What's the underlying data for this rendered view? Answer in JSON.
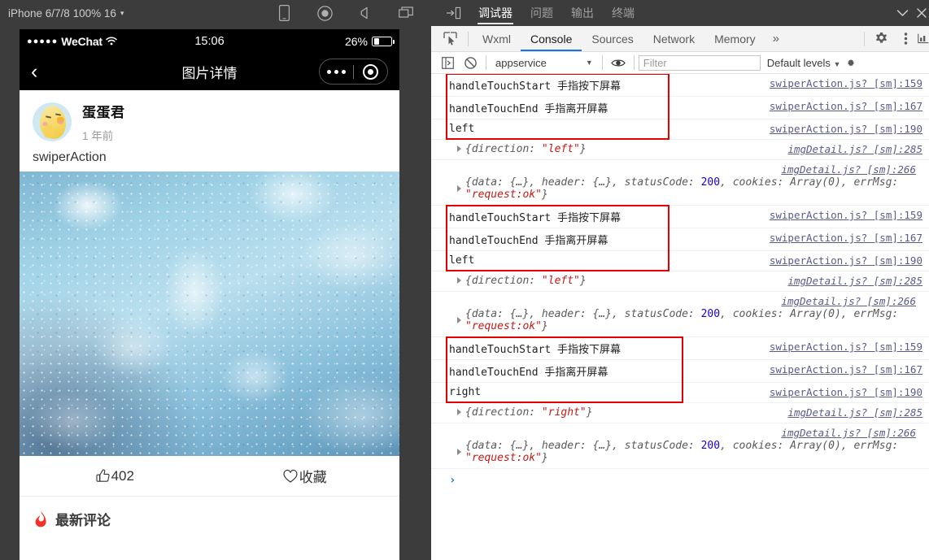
{
  "simulator": {
    "device_label": "iPhone 6/7/8 100% 16",
    "caret": "▾",
    "toolbar_icons": [
      "device-icon",
      "record-icon",
      "volume-icon",
      "windows-icon"
    ],
    "phone": {
      "status_bar": {
        "signal_dots": "●●●●●",
        "carrier": "WeChat",
        "wifi": "wifi-icon",
        "time": "15:06",
        "battery_percent": "26%"
      },
      "nav_bar": {
        "back": "‹",
        "title": "图片详情",
        "capsule": [
          "more-dots-icon",
          "target-icon"
        ]
      },
      "post": {
        "user_name": "蛋蛋君",
        "time_ago": "1 年前",
        "caption": "swiperAction",
        "image_alt": "ice-texture-image",
        "like_count": "402",
        "like_icon": "thumbs-up-icon",
        "favorite_label": "收藏",
        "favorite_icon": "heart-icon",
        "comments_title": "最新评论",
        "comments_icon": "flame-icon"
      }
    }
  },
  "devtools": {
    "panel_icon": "open-panel-icon",
    "top_tabs": [
      {
        "label": "调试器",
        "active": true
      },
      {
        "label": "问题",
        "active": false
      },
      {
        "label": "输出",
        "active": false
      },
      {
        "label": "终端",
        "active": false
      }
    ],
    "top_right_icons": [
      "chevron-down-icon",
      "close-icon"
    ],
    "inspect_icon": "inspect-element-icon",
    "sub_tabs": [
      {
        "label": "Wxml",
        "active": false
      },
      {
        "label": "Console",
        "active": true
      },
      {
        "label": "Sources",
        "active": false
      },
      {
        "label": "Network",
        "active": false
      },
      {
        "label": "Memory",
        "active": false
      }
    ],
    "more_tabs": "»",
    "sub_right_icons": [
      "gear-icon",
      "kebab-menu-icon",
      "chart-icon"
    ],
    "filter_bar": {
      "sidebar_icon": "console-sidebar-icon",
      "clear_icon": "clear-console-icon",
      "context": "appservice",
      "context_caret": "▼",
      "eye_icon": "eye-icon",
      "filter_value": "",
      "filter_placeholder": "Filter",
      "levels": "Default levels",
      "levels_caret": "▼",
      "settings_icon": "settings-icon"
    },
    "console_rows": [
      {
        "type": "log",
        "text": "handleTouchStart  手指按下屏幕",
        "src": "swiperAction.js? [sm]:159",
        "boxed": true
      },
      {
        "type": "log",
        "text": "handleTouchEnd  手指离开屏幕",
        "src": "swiperAction.js? [sm]:167",
        "boxed": true
      },
      {
        "type": "log",
        "text": "left",
        "src": "swiperAction.js? [sm]:190",
        "boxed": true
      },
      {
        "type": "object",
        "text": "{direction: \"left\"}",
        "value": "left",
        "src": "imgDetail.js? [sm]:285"
      },
      {
        "type": "object-multiline",
        "src": "imgDetail.js? [sm]:266",
        "status_code": "200",
        "err_msg": "request:ok"
      },
      {
        "type": "log",
        "text": "handleTouchStart  手指按下屏幕",
        "src": "swiperAction.js? [sm]:159",
        "boxed": true
      },
      {
        "type": "log",
        "text": "handleTouchEnd  手指离开屏幕",
        "src": "swiperAction.js? [sm]:167",
        "boxed": true
      },
      {
        "type": "log",
        "text": "left",
        "src": "swiperAction.js? [sm]:190",
        "boxed": true
      },
      {
        "type": "object",
        "text": "{direction: \"left\"}",
        "value": "left",
        "src": "imgDetail.js? [sm]:285"
      },
      {
        "type": "object-multiline",
        "src": "imgDetail.js? [sm]:266",
        "status_code": "200",
        "err_msg": "request:ok"
      },
      {
        "type": "log",
        "text": "handleTouchStart  手指按下屏幕",
        "src": "swiperAction.js? [sm]:159",
        "boxed": true
      },
      {
        "type": "log",
        "text": "handleTouchEnd  手指离开屏幕",
        "src": "swiperAction.js? [sm]:167",
        "boxed": true
      },
      {
        "type": "log",
        "text": "right",
        "src": "swiperAction.js? [sm]:190",
        "boxed": true
      },
      {
        "type": "object",
        "text": "{direction: \"right\"}",
        "value": "right",
        "src": "imgDetail.js? [sm]:285"
      },
      {
        "type": "object-multiline",
        "src": "imgDetail.js? [sm]:266",
        "status_code": "200",
        "err_msg": "request:ok"
      }
    ],
    "object_prefix": "{data: {…}, header: {…}, statusCode: ",
    "object_mid": ", cookies: Array(0), errMsg:",
    "object_tail_open": "\"",
    "object_tail_close": "\"}",
    "direction_key": "{direction: ",
    "prompt_symbol": "›"
  },
  "colors": {
    "accent_blue": "#1a73e8",
    "redbox": "#e40000",
    "string_red": "#c41a16",
    "number_blue": "#1c00cf",
    "toolbar_dark": "#3c3c3c"
  }
}
